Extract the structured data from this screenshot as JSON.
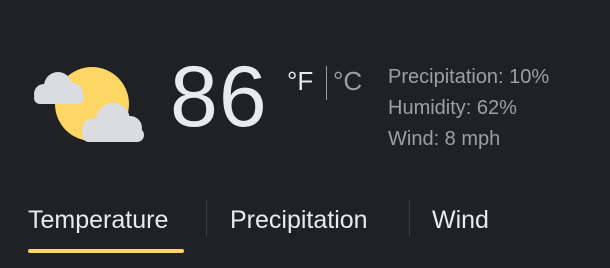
{
  "weather": {
    "icon": "partly-cloudy-icon",
    "temperature": "86",
    "unit_f": "°F",
    "unit_c": "°C",
    "selected_unit": "°F"
  },
  "details": {
    "precipitation": "Precipitation: 10%",
    "humidity": "Humidity: 62%",
    "wind": "Wind: 8 mph"
  },
  "tabs": [
    {
      "label": "Temperature",
      "selected": true
    },
    {
      "label": "Precipitation",
      "selected": false
    },
    {
      "label": "Wind",
      "selected": false
    }
  ],
  "colors": {
    "background": "#202124",
    "primary_text": "#e8eaed",
    "secondary_text": "#9aa0a6",
    "accent": "#fdd663"
  }
}
